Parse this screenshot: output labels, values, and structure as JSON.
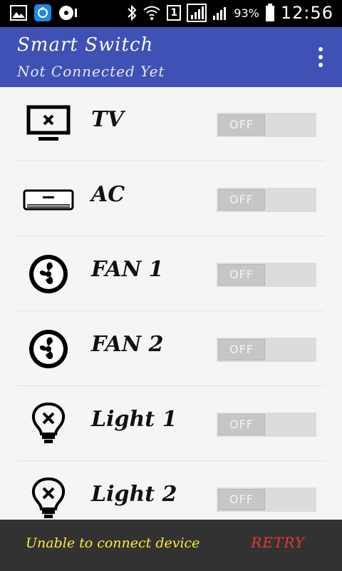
{
  "status_bar": {
    "sim_slot": "1",
    "battery_percent": "93%",
    "time": "12:56"
  },
  "app_bar": {
    "title": "Smart Switch",
    "subtitle": "Not Connected Yet"
  },
  "devices": [
    {
      "label": "TV",
      "icon": "tv-icon",
      "state": "OFF"
    },
    {
      "label": "AC",
      "icon": "ac-icon",
      "state": "OFF"
    },
    {
      "label": "FAN 1",
      "icon": "fan-icon",
      "state": "OFF"
    },
    {
      "label": "FAN 2",
      "icon": "fan-icon",
      "state": "OFF"
    },
    {
      "label": "Light 1",
      "icon": "bulb-icon",
      "state": "OFF"
    },
    {
      "label": "Light 2",
      "icon": "bulb-icon",
      "state": "OFF"
    }
  ],
  "snackbar": {
    "message": "Unable to connect device",
    "action": "RETRY"
  },
  "colors": {
    "app_bar": "#3f51b5",
    "snackbar_message": "#ffeb3b",
    "snackbar_action": "#e53935"
  }
}
